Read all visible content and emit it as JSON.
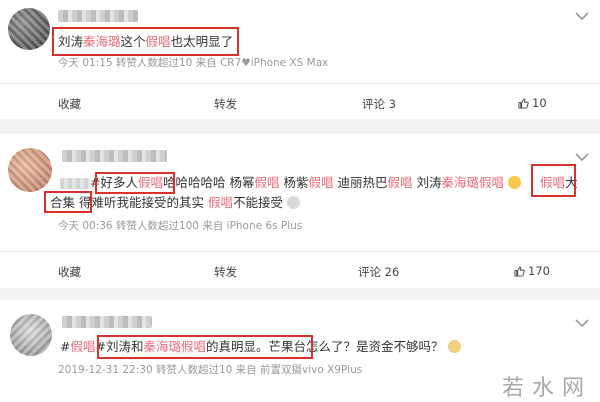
{
  "posts": [
    {
      "segments": [
        {
          "t": "刘涛",
          "c": ""
        },
        {
          "t": "秦海璐",
          "c": "red"
        },
        {
          "t": "这个",
          "c": ""
        },
        {
          "t": "假唱",
          "c": "red"
        },
        {
          "t": "也太明显了",
          "c": ""
        }
      ],
      "meta": "今天 01:15 转赞人数超过10  来自 CR7♥iPhone XS Max",
      "actions": {
        "favorite": "收藏",
        "repost": "转发",
        "comment": "评论 3",
        "like": "10"
      }
    },
    {
      "line1": [
        {
          "t": "#好多人",
          "c": ""
        },
        {
          "t": "假唱",
          "c": "red"
        },
        {
          "t": "哈哈哈哈哈  杨幂",
          "c": ""
        },
        {
          "t": "假唱",
          "c": "red"
        },
        {
          "t": "  杨紫",
          "c": ""
        },
        {
          "t": "假唱",
          "c": "red"
        },
        {
          "t": "  迪丽热巴",
          "c": ""
        },
        {
          "t": "假唱",
          "c": "red"
        },
        {
          "t": "  刘涛",
          "c": ""
        },
        {
          "t": "秦海璐",
          "c": "red"
        },
        {
          "t": "假唱",
          "c": "red"
        }
      ],
      "line1_tail": [
        {
          "t": "假唱",
          "c": "red"
        },
        {
          "t": "大",
          "c": ""
        }
      ],
      "line2": [
        {
          "t": "合集",
          "c": ""
        },
        {
          "t": "   得难听我能接受的其实 ",
          "c": ""
        },
        {
          "t": "假唱",
          "c": "red"
        },
        {
          "t": "不能接受",
          "c": ""
        }
      ],
      "meta": "今天 00:36 转赞人数超过100  来自 iPhone 6s Plus",
      "actions": {
        "favorite": "收藏",
        "repost": "转发",
        "comment": "评论 26",
        "like": "170"
      }
    },
    {
      "segments": [
        {
          "t": "#",
          "c": ""
        },
        {
          "t": "假唱",
          "c": "red"
        },
        {
          "t": "#刘涛和",
          "c": ""
        },
        {
          "t": "秦海璐假唱",
          "c": "red"
        },
        {
          "t": "的真明显。芒果台怎么了？是资金不够吗？",
          "c": ""
        }
      ],
      "meta": "2019-12-31 22:30 转赞人数超过10  来自 前置双摄vivo X9Plus"
    }
  ],
  "watermark": "若水网",
  "colors": {
    "highlight": "#d9322e",
    "keyword": "#e86b7a",
    "meta": "#999999"
  }
}
